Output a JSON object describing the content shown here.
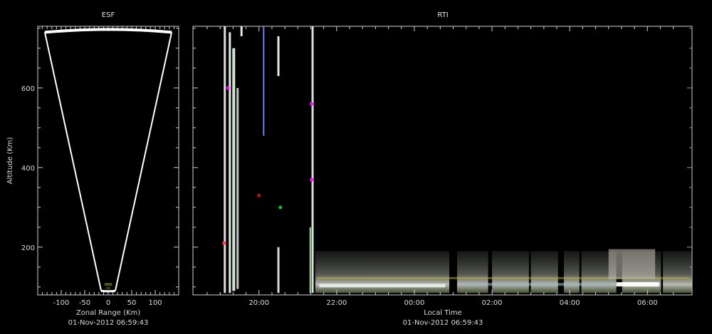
{
  "chart_data": [
    {
      "panel": "esf",
      "type": "other",
      "title": "ESF",
      "xlabel": "Zonal Range (Km)",
      "ylabel": "Altitude (Km)",
      "timestamp": "01-Nov-2012 06:59:43",
      "xlim": [
        -150,
        150
      ],
      "ylim": [
        80,
        755
      ],
      "x_ticks": [
        -100,
        -50,
        0,
        50,
        100
      ],
      "x_tick_labels": [
        "-100",
        "-50",
        "0",
        "50",
        "100"
      ],
      "y_ticks": [
        200,
        400,
        600
      ],
      "y_tick_labels": [
        "200",
        "400",
        "600"
      ],
      "fan": {
        "bottom_x": [
          -15,
          15
        ],
        "bottom_y": 90,
        "top_x": [
          -135,
          135
        ],
        "top_y": 740
      }
    },
    {
      "panel": "rti",
      "type": "heatmap",
      "title": "RTI",
      "xlabel": "Local Time",
      "timestamp": "01-Nov-2012 06:59:43",
      "xlim_hours": [
        18.3,
        31.15
      ],
      "ylim": [
        80,
        755
      ],
      "x_ticks_hours": [
        20,
        22,
        24,
        26,
        28,
        30
      ],
      "x_tick_labels": [
        "20:00",
        "22:00",
        "00:00",
        "02:00",
        "04:00",
        "06:00"
      ],
      "y_ticks": [
        200,
        400,
        600
      ]
    }
  ]
}
